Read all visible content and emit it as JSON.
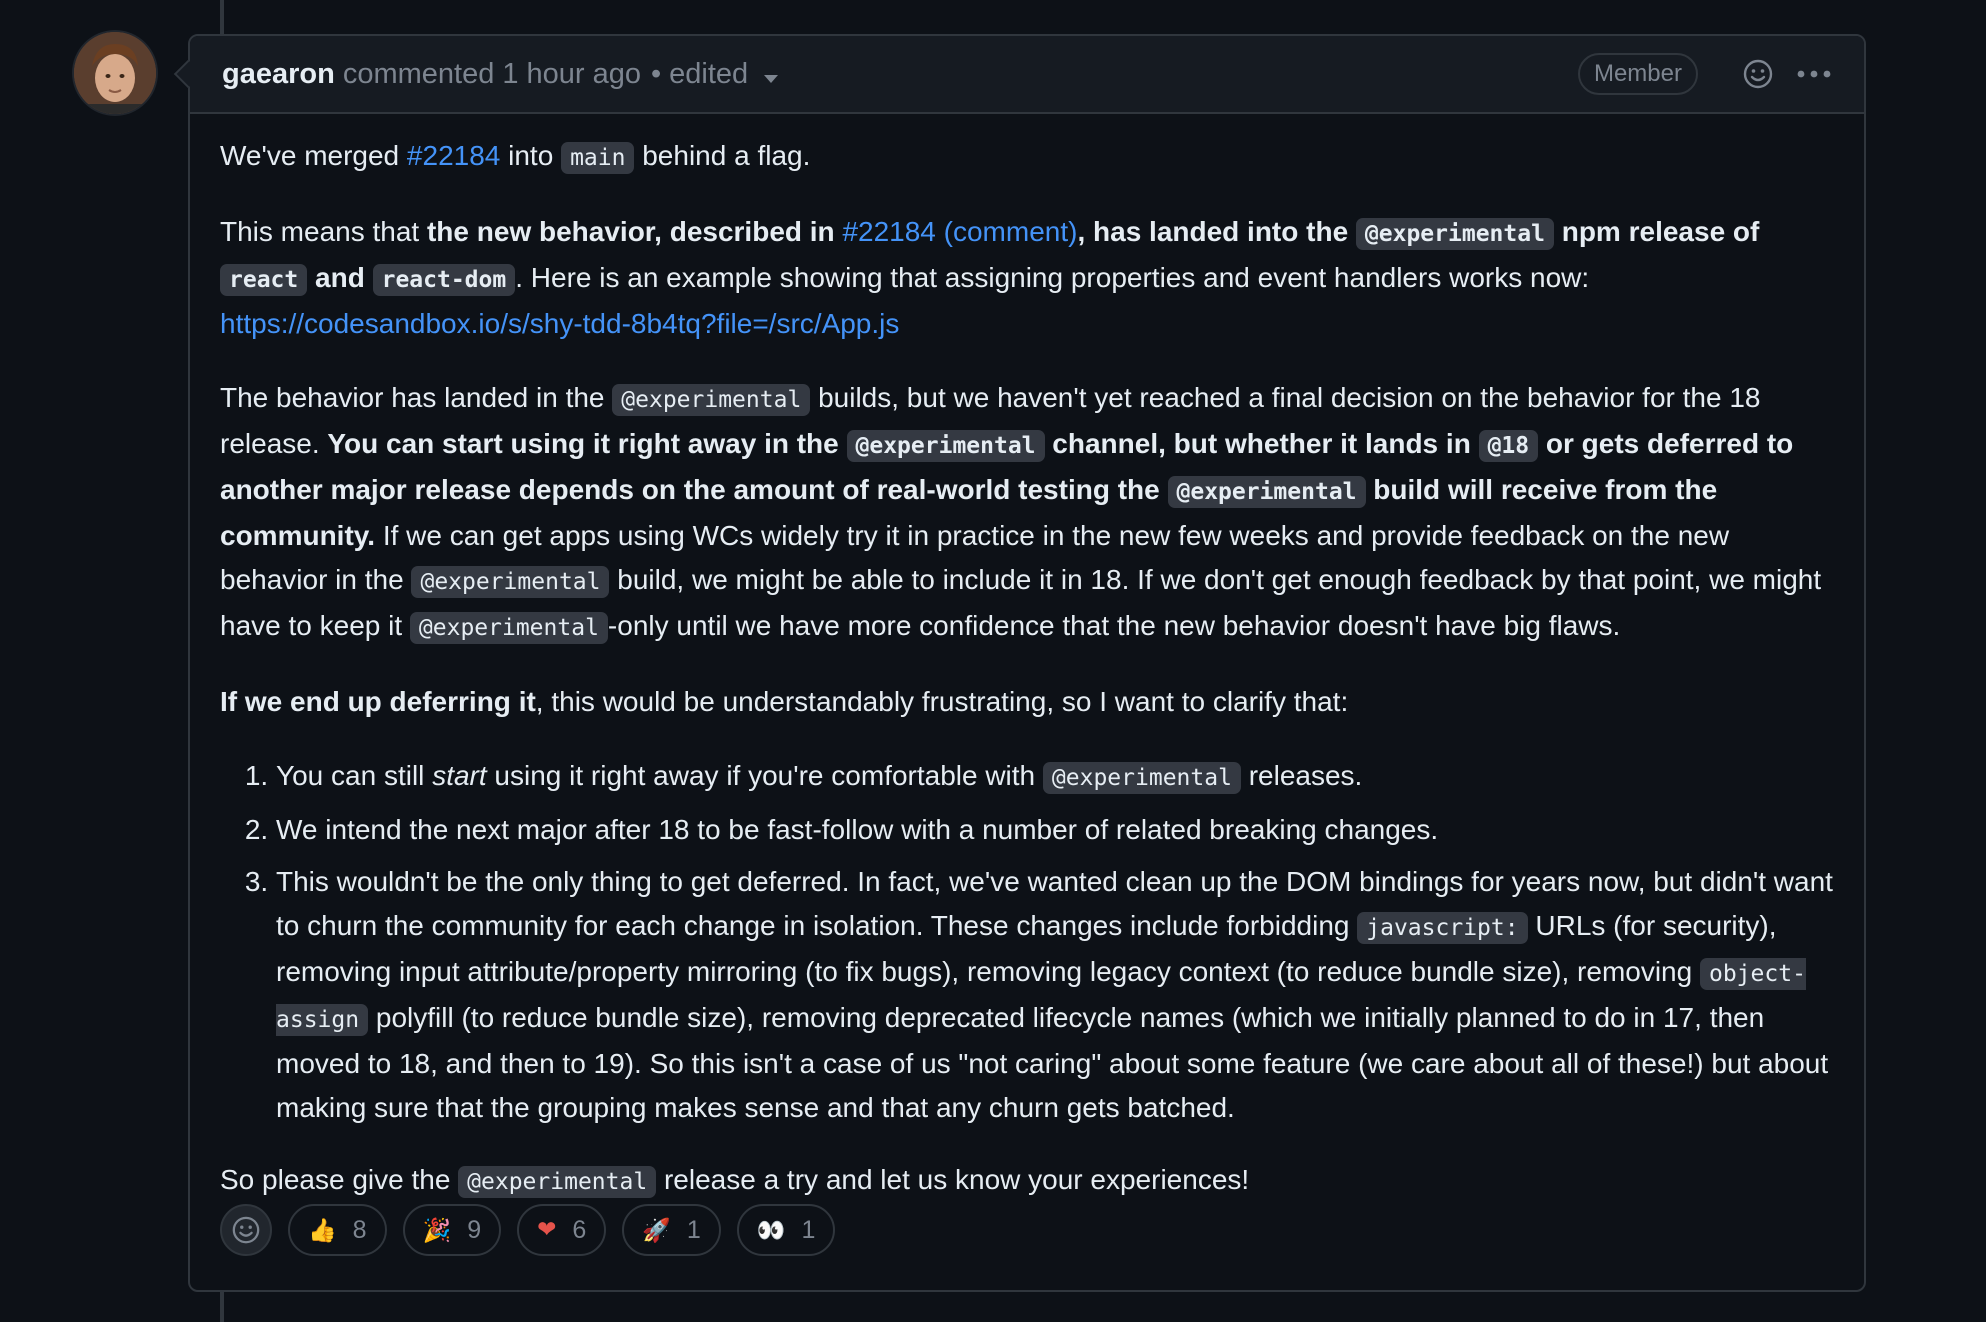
{
  "comment": {
    "author": "gaearon",
    "action": "commented",
    "time": "1 hour ago",
    "separator": "•",
    "edited": "edited",
    "role_badge": "Member",
    "icons": {
      "add_reaction": "smiley-icon",
      "more": "kebab-horizontal-icon"
    }
  },
  "body": {
    "p1": {
      "t1": "We've merged ",
      "link": "#22184",
      "t2": " into ",
      "code": "main",
      "t3": " behind a flag."
    },
    "p2": {
      "t1": "This means that ",
      "b1": "the new behavior, described in ",
      "link": "#22184 (comment)",
      "b2": ", has landed into the ",
      "code1": "@experimental",
      "b3": " npm release of",
      "code2": "react",
      "b4": " and ",
      "code3": "react-dom",
      "t2": ". Here is an example showing that assigning properties and event handlers works now:",
      "url": "https://codesandbox.io/s/shy-tdd-8b4tq?file=/src/App.js"
    },
    "p3": {
      "t1": "The behavior has landed in the ",
      "code1": "@experimental",
      "t2": " builds, but we haven't yet reached a final decision on the behavior for the 18 release. ",
      "b1": "You can start using it right away in the ",
      "code2": "@experimental",
      "b2": " channel, but whether it lands in ",
      "code3": "@18",
      "b3": " or gets deferred to another major release depends on the amount of real-world testing the ",
      "code4": "@experimental",
      "b4": " build will receive from the community.",
      "t3": " If we can get apps using WCs widely try it in practice in the new few weeks and provide feedback on the new behavior in the ",
      "code5": "@experimental",
      "t4": " build, we might be able to include it in 18. If we don't get enough feedback by that point, we might have to keep it ",
      "code6": "@experimental",
      "t5": "-only until we have more confidence that the new behavior doesn't have big flaws."
    },
    "p4": {
      "b1": "If we end up deferring it",
      "t1": ", this would be understandably frustrating, so I want to clarify that:"
    },
    "list": {
      "i1": {
        "t1": "You can still ",
        "em": "start",
        "t2": " using it right away if you're comfortable with ",
        "code": "@experimental",
        "t3": " releases."
      },
      "i2": {
        "t1": "We intend the next major after 18 to be fast-follow with a number of related breaking changes."
      },
      "i3": {
        "t1": "This wouldn't be the only thing to get deferred. In fact, we've wanted clean up the DOM bindings for years now, but didn't want to churn the community for each change in isolation. These changes include forbidding ",
        "code1": "javascript:",
        "t2": " URLs (for security), removing input attribute/property mirroring (to fix bugs), removing legacy context (to reduce bundle size), removing ",
        "code2": "object-assign",
        "t3": " polyfill (to reduce bundle size), removing deprecated lifecycle names (which we initially planned to do in 17, then moved to 18, and then to 19). So this isn't a case of us \"not caring\" about some feature (we care about all of these!) but about making sure that the grouping makes sense and that any churn gets batched."
      }
    },
    "p5": {
      "t1": "So please give the ",
      "code": "@experimental",
      "t2": " release a try and let us know your experiences!"
    }
  },
  "reactions": [
    {
      "icon": "thumbs-up-icon",
      "glyph": "👍",
      "count": "8"
    },
    {
      "icon": "tada-icon",
      "glyph": "🎉",
      "count": "9"
    },
    {
      "icon": "heart-icon",
      "glyph": "❤",
      "count": "6"
    },
    {
      "icon": "rocket-icon",
      "glyph": "🚀",
      "count": "1"
    },
    {
      "icon": "eyes-icon",
      "glyph": "👀",
      "count": "1"
    }
  ],
  "colors": {
    "background": "#0d1117",
    "header_bg": "#161b22",
    "border": "#30363d",
    "text": "#e6edf3",
    "muted": "#7d8590",
    "link": "#4493f8",
    "code_bg": "#343942"
  }
}
